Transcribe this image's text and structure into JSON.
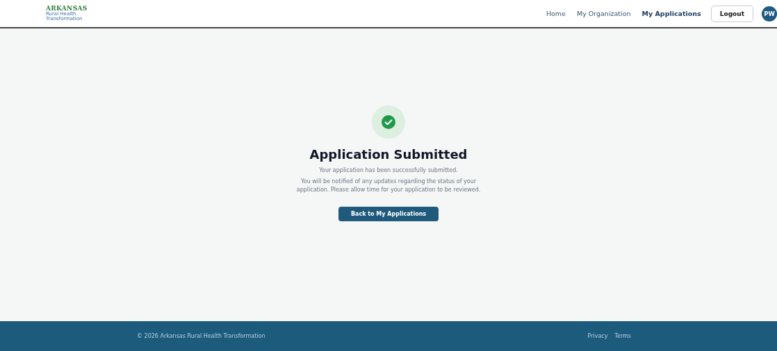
{
  "logo": {
    "title": "ARKANSAS",
    "subtitle_lines": [
      "Rural Health",
      "Transformation"
    ]
  },
  "nav": {
    "links": [
      {
        "label": "Home",
        "selected": false
      },
      {
        "label": "My Organization",
        "selected": false
      },
      {
        "label": "My Applications",
        "selected": true
      }
    ],
    "logout": "Logout",
    "avatar": "PW"
  },
  "confirmation": {
    "title": "Application Submitted",
    "message": "Your application has been successfully submitted.",
    "details": "You will be notified of any updates regarding the status of your application. Please allow time for your application to be reviewed.",
    "button": "Back to My Applications"
  },
  "footer": {
    "copyright": "© 2026 Arkansas Rural Health Transformation",
    "links": [
      "Privacy",
      "Terms"
    ]
  }
}
